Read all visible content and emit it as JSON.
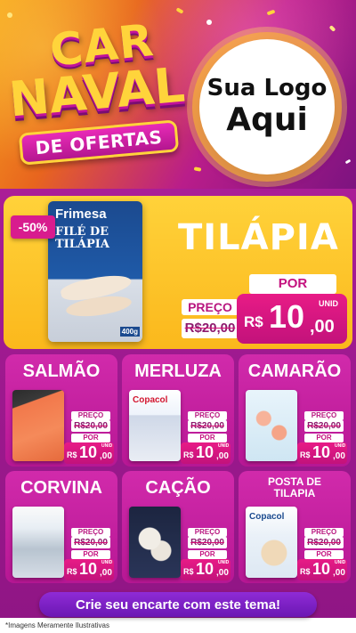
{
  "header": {
    "logo_word_1": "CAR",
    "logo_word_2": "NAVAL",
    "logo_subtitle": "DE OFERTAS",
    "store_logo_line_1": "Sua Logo",
    "store_logo_line_2": "Aqui"
  },
  "colors": {
    "accent_pink": "#d81c8e",
    "brand_yellow": "#ffd43b",
    "card_purple": "#b71794",
    "cta_purple": "#6b17b3"
  },
  "featured": {
    "discount": "-50%",
    "product_brand": "Frimesa",
    "product_name": "FILÉ DE TILÁPIA",
    "product_weight": "400g",
    "title": "TILÁPIA",
    "price_label": "PREÇO",
    "old_price": "R$20,00",
    "por_label": "POR",
    "unit_label": "UNID",
    "currency": "R$",
    "price_integer": "10",
    "price_decimal": ",00"
  },
  "products": [
    {
      "name": "SALMÃO",
      "price_label": "PREÇO",
      "old_price": "R$20,00",
      "por_label": "POR",
      "unit_label": "UNID",
      "currency": "R$",
      "price_integer": "10",
      "price_decimal": ",00"
    },
    {
      "name": "MERLUZA",
      "brand": "Copacol",
      "price_label": "PREÇO",
      "old_price": "R$20,00",
      "por_label": "POR",
      "unit_label": "UNID",
      "currency": "R$",
      "price_integer": "10",
      "price_decimal": ",00"
    },
    {
      "name": "CAMARÃO",
      "price_label": "PREÇO",
      "old_price": "R$20,00",
      "por_label": "POR",
      "unit_label": "UNID",
      "currency": "R$",
      "price_integer": "10",
      "price_decimal": ",00"
    },
    {
      "name": "CORVINA",
      "price_label": "PREÇO",
      "old_price": "R$20,00",
      "por_label": "POR",
      "unit_label": "UNID",
      "currency": "R$",
      "price_integer": "10",
      "price_decimal": ",00"
    },
    {
      "name": "CAÇÃO",
      "price_label": "PREÇO",
      "old_price": "R$20,00",
      "por_label": "POR",
      "unit_label": "UNID",
      "currency": "R$",
      "price_integer": "10",
      "price_decimal": ",00"
    },
    {
      "name": "POSTA DE TILAPIA",
      "brand": "Copacol",
      "price_label": "PREÇO",
      "old_price": "R$20,00",
      "por_label": "POR",
      "unit_label": "UNID",
      "currency": "R$",
      "price_integer": "10",
      "price_decimal": ",00"
    }
  ],
  "footer": {
    "cta": "Crie seu encarte com este tema!",
    "disclaimer": "*Imagens Meramente Ilustrativas"
  }
}
